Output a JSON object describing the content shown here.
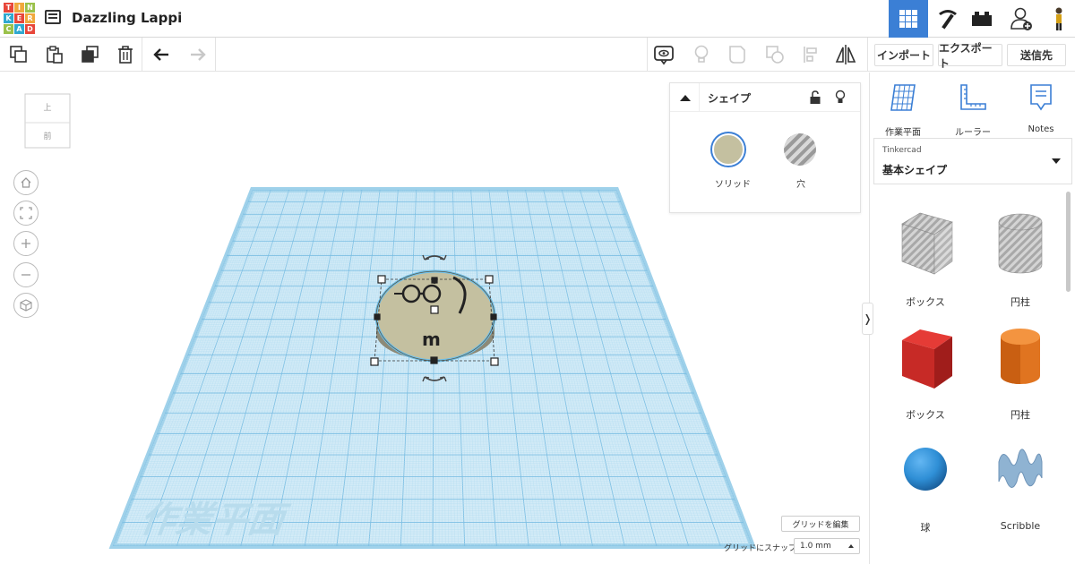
{
  "app": {
    "logo_letters": [
      "T",
      "I",
      "N",
      "K",
      "E",
      "R",
      "C",
      "A",
      "D"
    ],
    "logo_colors": [
      "#e8463a",
      "#f0a83c",
      "#9ac14a",
      "#2fa8d0",
      "#e8463a",
      "#f0a83c",
      "#9ac14a",
      "#2fa8d0",
      "#e8463a"
    ],
    "project_title": "Dazzling Lappi"
  },
  "toolbar": {
    "import_label": "インポート",
    "export_label": "エクスポート",
    "send_label": "送信先"
  },
  "viewcube": {
    "top_label": "上",
    "front_label": "前"
  },
  "inspector": {
    "title": "シェイプ",
    "solid_label": "ソリッド",
    "hole_label": "穴",
    "solid_color": "#c4c0a0"
  },
  "workplane": {
    "watermark": "作業平面",
    "object_text": "m"
  },
  "right_panel": {
    "tools": [
      {
        "label": "作業平面"
      },
      {
        "label": "ルーラー"
      },
      {
        "label": "Notes"
      }
    ],
    "library_source": "Tinkercad",
    "library_name": "基本シェイプ",
    "shapes": [
      {
        "label": "ボックス"
      },
      {
        "label": "円柱"
      },
      {
        "label": "ボックス"
      },
      {
        "label": "円柱"
      },
      {
        "label": "球"
      },
      {
        "label": "Scribble"
      }
    ]
  },
  "grid_controls": {
    "edit_grid_label": "グリッドを編集",
    "snap_label": "グリッドにスナップ",
    "snap_value": "1.0 mm"
  },
  "colors": {
    "accent": "#3b7fd5",
    "workplane_fill": "#cfe8f5",
    "workplane_line": "#8cc8e8",
    "box_red": "#d22a28",
    "cylinder_orange": "#e8771f",
    "sphere_blue": "#2f8fd6"
  }
}
